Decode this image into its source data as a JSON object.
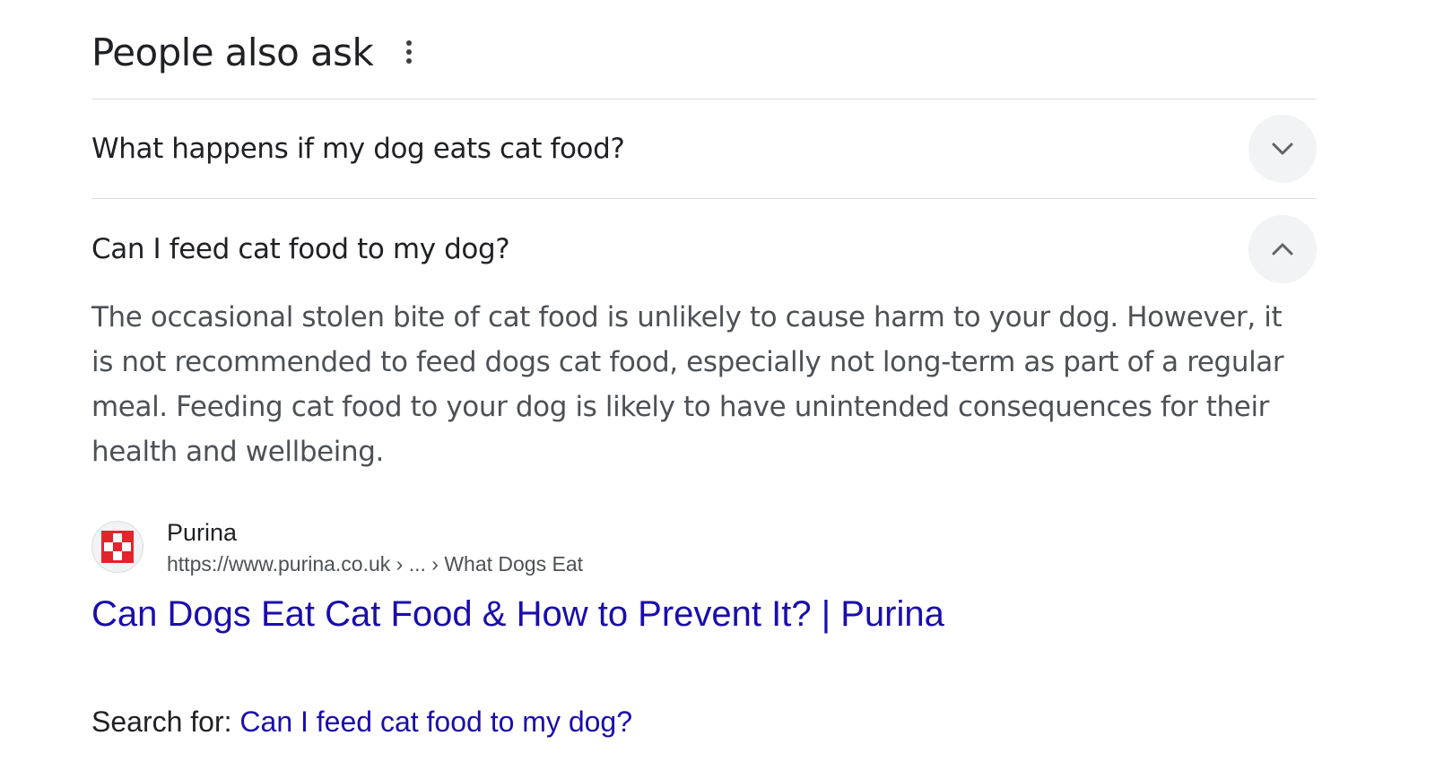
{
  "paa": {
    "title": "People also ask",
    "more_icon": "more-vert-icon",
    "questions": [
      {
        "text": "What happens if my dog eats cat food?",
        "expanded": false,
        "icon": "chevron-down-icon"
      },
      {
        "text": "Can I feed cat food to my dog?",
        "expanded": true,
        "icon": "chevron-up-icon",
        "answer": "The occasional stolen bite of cat food is unlikely to cause harm to your dog. However, it is not recommended to feed dogs cat food, especially not long-term as part of a regular meal. Feeding cat food to your dog is likely to have unintended consequences for their health and wellbeing.",
        "source": {
          "name": "Purina",
          "url": "https://www.purina.co.uk › ... › What Dogs Eat",
          "favicon": "purina-checkerboard-icon",
          "title": "Can Dogs Eat Cat Food & How to Prevent It? | Purina"
        }
      }
    ]
  },
  "search_for": {
    "label": "Search for: ",
    "query": "Can I feed cat food to my dog?"
  },
  "colors": {
    "link": "#1a0dab",
    "text": "#202124",
    "secondary_text": "#4d5156",
    "divider": "#dadce0",
    "button_bg": "#f1f3f4",
    "purina_red": "#e3242b"
  }
}
